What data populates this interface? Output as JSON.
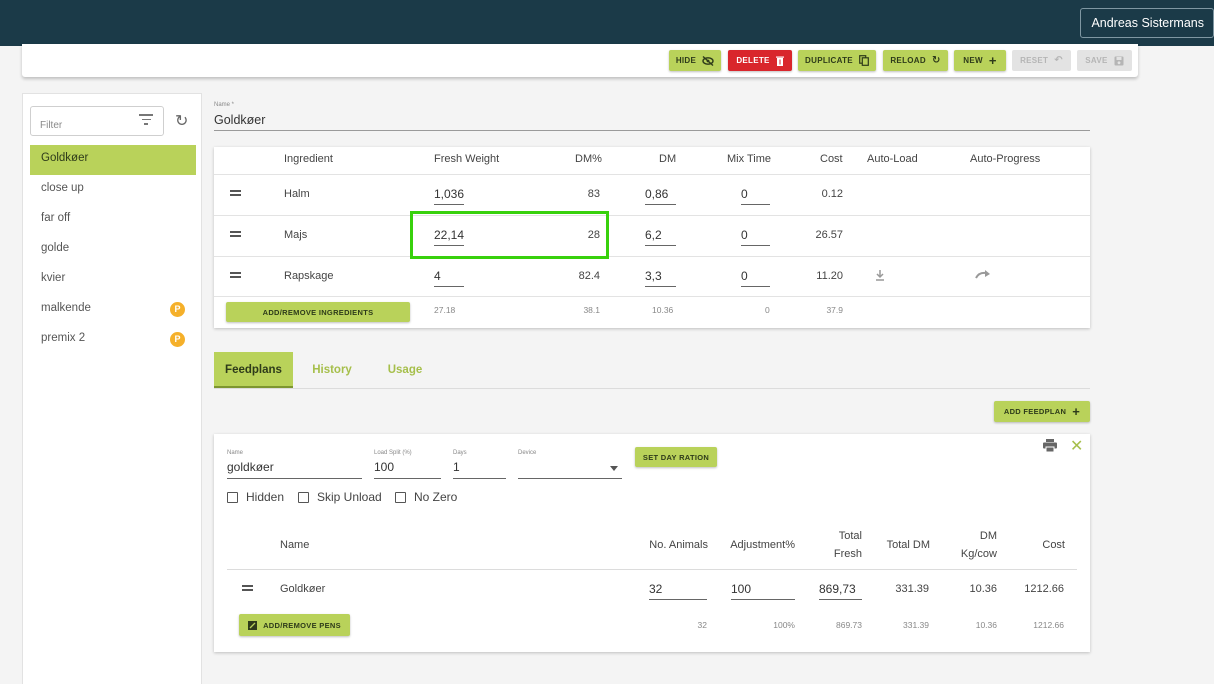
{
  "topbar": {
    "user": "Andreas Sistermans"
  },
  "toolbar": {
    "hide": "HIDE",
    "delete": "DELETE",
    "duplicate": "DUPLICATE",
    "reload": "RELOAD",
    "new": "NEW",
    "reset": "RESET",
    "save": "SAVE"
  },
  "sidebar": {
    "filter_placeholder": "Filter",
    "items": [
      {
        "label": "Goldkøer",
        "selected": true,
        "badge": ""
      },
      {
        "label": "close up",
        "badge": ""
      },
      {
        "label": "far off",
        "badge": ""
      },
      {
        "label": "golde",
        "badge": ""
      },
      {
        "label": "kvier",
        "badge": ""
      },
      {
        "label": "malkende",
        "badge": "P"
      },
      {
        "label": "premix 2",
        "badge": "P"
      }
    ]
  },
  "ration": {
    "name_label": "Name *",
    "name": "Goldkøer"
  },
  "ingredients": {
    "headers": {
      "ingredient": "Ingredient",
      "fresh": "Fresh Weight",
      "dmp": "DM%",
      "dm": "DM",
      "mix": "Mix Time",
      "cost": "Cost",
      "autoload": "Auto-Load",
      "autoprog": "Auto-Progress"
    },
    "rows": [
      {
        "name": "Halm",
        "fresh": "1,036",
        "dmp": "83",
        "dm": "0,86",
        "mix": "0",
        "cost": "0.12"
      },
      {
        "name": "Majs",
        "fresh": "22,14",
        "dmp": "28",
        "dm": "6,2",
        "mix": "0",
        "cost": "26.57"
      },
      {
        "name": "Rapskage",
        "fresh": "4",
        "dmp": "82.4",
        "dm": "3,3",
        "mix": "0",
        "cost": "11.20"
      }
    ],
    "add_button": "ADD/REMOVE INGREDIENTS",
    "totals": {
      "fresh": "27.18",
      "dmp": "38.1",
      "dm": "10.36",
      "mix": "0",
      "cost": "37.9"
    }
  },
  "tabs": {
    "feedplans": "Feedplans",
    "history": "History",
    "usage": "Usage"
  },
  "add_feedplan": "ADD FEEDPLAN",
  "feedplan": {
    "name_label": "Name",
    "name": "goldkøer",
    "split_label": "Load Split (%)",
    "split": "100",
    "days_label": "Days",
    "days": "1",
    "device_label": "Device",
    "device": "",
    "set_day_ration": "SET DAY RATION",
    "checks": {
      "hidden": "Hidden",
      "skip_unload": "Skip Unload",
      "no_zero": "No Zero"
    },
    "headers": {
      "name": "Name",
      "animals": "No. Animals",
      "adjust": "Adjustment%",
      "total_fresh_1": "Total",
      "total_fresh_2": "Fresh",
      "total_dm": "Total DM",
      "dmkg_1": "DM",
      "dmkg_2": "Kg/cow",
      "cost": "Cost"
    },
    "row": {
      "name": "Goldkøer",
      "animals": "32",
      "adjust": "100",
      "fresh": "869,73",
      "dm": "331.39",
      "dmkg": "10.36",
      "cost": "1212.66"
    },
    "add_pens": "ADD/REMOVE PENS",
    "totals": {
      "animals": "32",
      "adjust": "100%",
      "fresh": "869.73",
      "dm": "331.39",
      "dmkg": "10.36",
      "cost": "1212.66"
    }
  },
  "colors": {
    "header": "#1b3a48",
    "accent": "#b9d25a",
    "danger": "#d9262c",
    "highlight": "#38d10c",
    "badge": "#f5b02a"
  }
}
